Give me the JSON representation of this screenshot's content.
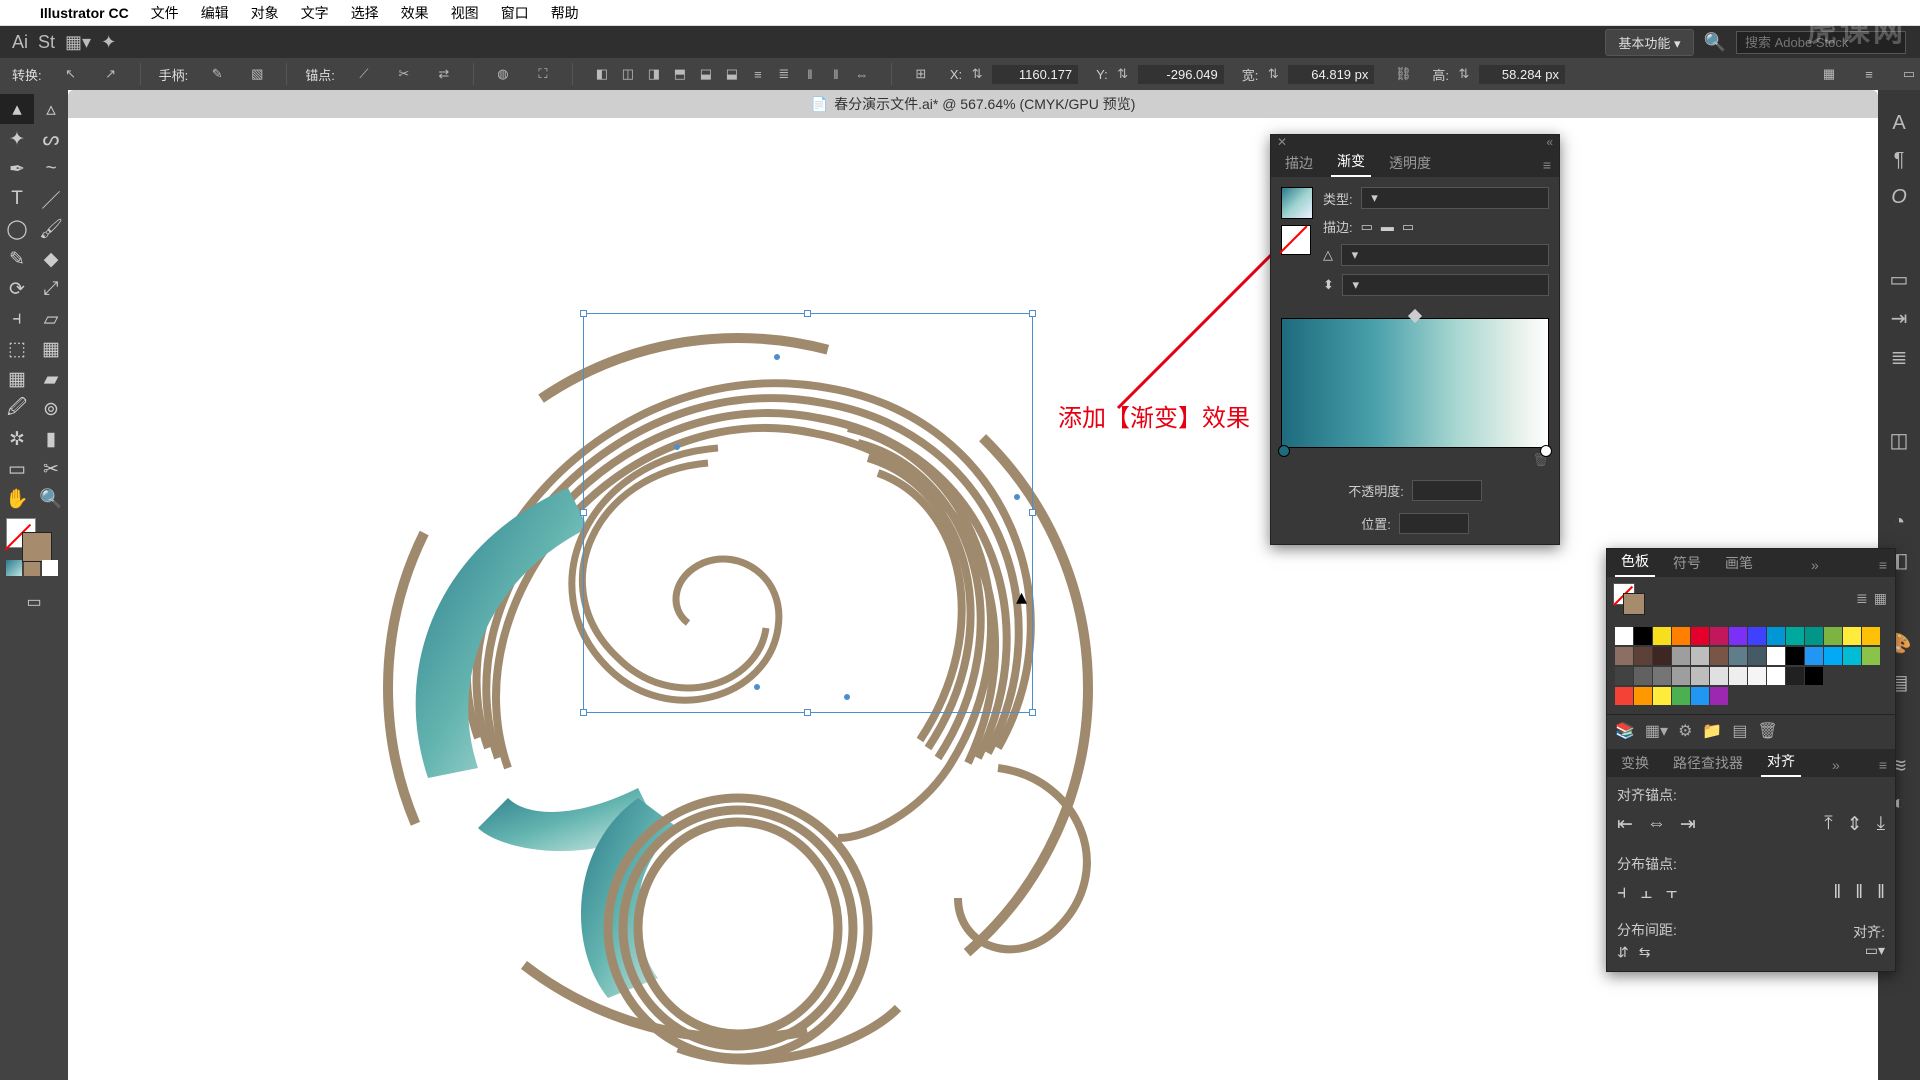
{
  "menubar": {
    "app_name": "Illustrator CC",
    "items": [
      "文件",
      "编辑",
      "对象",
      "文字",
      "选择",
      "效果",
      "视图",
      "窗口",
      "帮助"
    ]
  },
  "topbar": {
    "essentials_label": "基本功能",
    "search_placeholder": "搜索 Adobe Stock"
  },
  "control": {
    "transform_label": "转换:",
    "handle_label": "手柄:",
    "anchor_label": "锚点:",
    "x_label": "X:",
    "x_value": "1160.177",
    "y_label": "Y:",
    "y_value": "-296.049",
    "w_label": "宽:",
    "w_value": "64.819 px",
    "h_label": "高:",
    "h_value": "58.284 px"
  },
  "document": {
    "title": "春分演示文件.ai* @ 567.64% (CMYK/GPU 预览)"
  },
  "annotation": {
    "text": "添加【渐变】效果"
  },
  "gradient_panel": {
    "tabs": [
      "描边",
      "渐变",
      "透明度"
    ],
    "active_tab": 1,
    "type_label": "类型:",
    "stroke_label": "描边:",
    "opacity_label": "不透明度:",
    "location_label": "位置:"
  },
  "swatches_panel": {
    "tabs": [
      "色板",
      "符号",
      "画笔"
    ],
    "active_tab": 0,
    "colors_row1": [
      "#ffffff",
      "#000000",
      "#f7df1e",
      "#ff7f00",
      "#e4002b",
      "#c2185b",
      "#7b2ff7",
      "#4040ff",
      "#0097d6",
      "#00a99d",
      "#009688",
      "#7cb342",
      "#ffeb3b",
      "#ffc107"
    ],
    "colors_row2": [
      "#8d6e63",
      "#5d4037",
      "#3e2723",
      "#9e9e9e",
      "#bdbdbd",
      "#795548",
      "#607d8b",
      "#455a64",
      "#ffffff",
      "#000000",
      "#2196f3",
      "#03a9f4",
      "#00bcd4",
      "#8bc34a"
    ],
    "colors_row3": [
      "#424242",
      "#616161",
      "#757575",
      "#9e9e9e",
      "#bdbdbd",
      "#e0e0e0",
      "#eeeeee",
      "#f5f5f5",
      "#ffffff",
      "#212121",
      "#000000"
    ],
    "colors_row4": [
      "#f44336",
      "#ff9800",
      "#ffeb3b",
      "#4caf50",
      "#2196f3",
      "#9c27b0"
    ]
  },
  "align_panel": {
    "tabs": [
      "变换",
      "路径查找器",
      "对齐"
    ],
    "active_tab": 2,
    "align_anchor_label": "对齐锚点:",
    "distribute_anchor_label": "分布锚点:",
    "distribute_spacing_label": "分布间距:",
    "align_to_label": "对齐:"
  },
  "watermark": "虎课网"
}
